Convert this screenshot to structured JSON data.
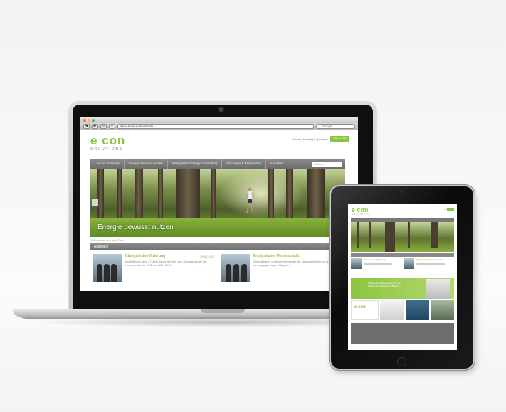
{
  "laptop": {
    "browser": {
      "url": "www.econ-solutions.de",
      "search_placeholder": "Google",
      "back": "◀",
      "forward": "▶"
    },
    "site": {
      "logo_main": "e con",
      "logo_sub": "SOLUTIONS",
      "toplinks": "Home | Kontakt | Impressum",
      "login_label": "log e con",
      "nav": [
        "e con Solutions",
        "Energie bewusst nutzen",
        "Intelligentes Energie Controlling",
        "Lösungen & Referenzen",
        "Aktuelles"
      ],
      "nav_search_placeholder": "Suchen",
      "hero_caption": "Energie bewusst nutzen",
      "breadcrumb": "Sie befinden sich hier: Start",
      "section_title": "Aktuelles",
      "section_more": "Alle",
      "news": [
        {
          "title": "Übergabe Zertifizierung",
          "date": "28.04.2011",
          "text": "Am Mittwoch, dem 27. April wurde auf dem zum Messestand auf der Hannover Messe 2011 das DIN 16001"
        },
        {
          "title": "Erfolgreicher Messeauftakt",
          "date": "",
          "text": "Überwältigend großes Interesse auf der Messeteilnahme von e con - Versorgungsanlagen Magazin ..."
        }
      ]
    }
  },
  "tablet": {
    "logo_main": "e con",
    "logo_sub": "SOLUTIONS",
    "news_titles": [
      "Übergabe Zertifizierung",
      "Erfolgreicher Messeauftakt"
    ],
    "banner_text": "Intelligentes Energiesystem für das intelligente Gebäude der Zukunft ...",
    "tile_logo": "e con"
  },
  "colors": {
    "brand_green": "#8bc43f",
    "nav_gray": "#7a7a7a"
  }
}
